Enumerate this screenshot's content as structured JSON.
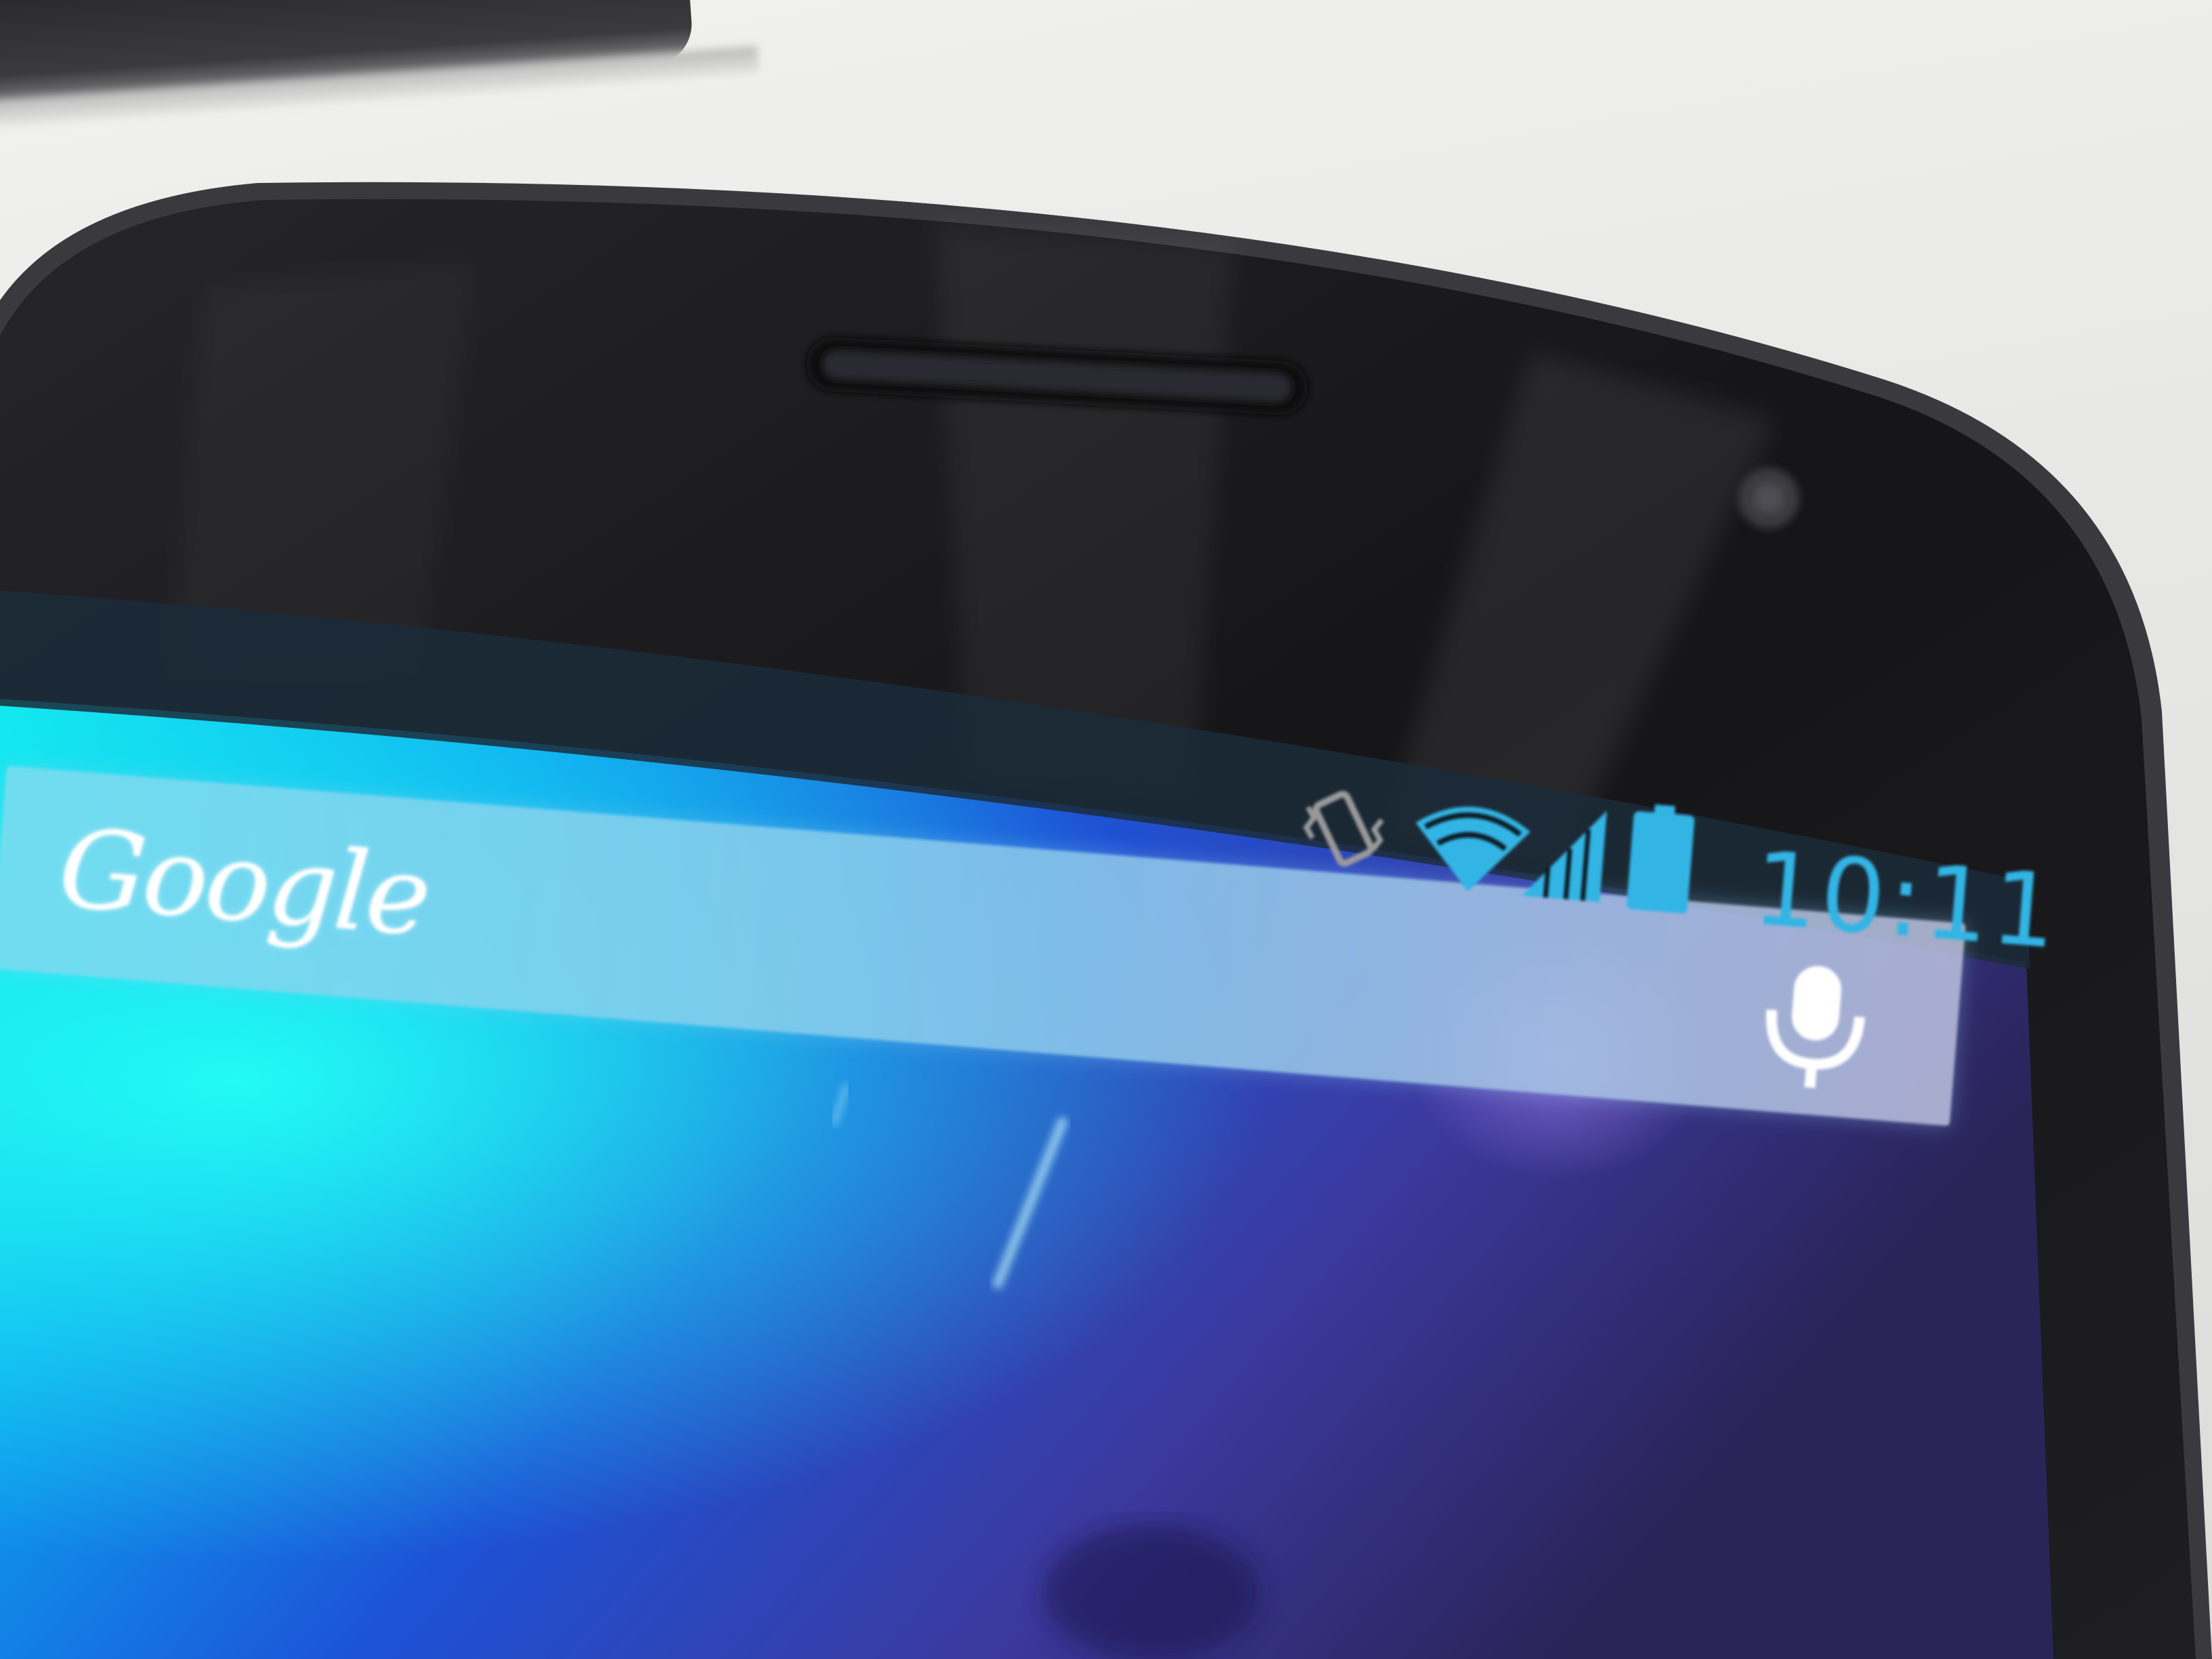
{
  "scene": {
    "description_colors": {
      "phone_body": "#1c1c1e",
      "status_accent": "#32b5e5",
      "search_bar": "#8fd6ee",
      "wallpaper_left": "#12e0f0",
      "wallpaper_right": "#3a2f7a"
    }
  },
  "search_widget": {
    "logo_text": "Google",
    "mic_icon": "microphone-icon"
  },
  "status_bar": {
    "time": "10:11",
    "icons": [
      "vibrate-icon",
      "wifi-icon",
      "signal-icon",
      "battery-icon"
    ]
  }
}
